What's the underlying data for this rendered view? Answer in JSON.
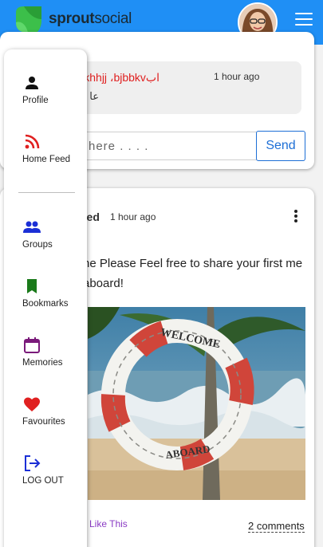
{
  "header": {
    "brand_bold": "sprout",
    "brand_rest": "social",
    "brand_color": "#1f8ff5"
  },
  "comment": {
    "author": "ابkhhjj ،bjbbkv",
    "time": "1 hour ago",
    "text": "عا"
  },
  "comment_input": {
    "placeholder": "here . . . .",
    "send_label": "Send"
  },
  "post": {
    "author": "hed",
    "time": "1 hour ago",
    "text": "he Please Feel free to share your first me aboard!",
    "image_text_top": "WELCOME",
    "image_text_bottom": "ABOARD",
    "like_label": "Like This",
    "comments_label": "2 comments"
  },
  "drawer": {
    "items": [
      {
        "label": "Profile",
        "icon": "person-icon",
        "color": "#111111"
      },
      {
        "label": "Home Feed",
        "icon": "rss-icon",
        "color": "#e02020"
      },
      {
        "label": "Groups",
        "icon": "groups-icon",
        "color": "#1b2fd6"
      },
      {
        "label": "Bookmarks",
        "icon": "bookmark-icon",
        "color": "#1a7a1a"
      },
      {
        "label": "Memories",
        "icon": "calendar-icon",
        "color": "#7a1a7a"
      },
      {
        "label": "Favourites",
        "icon": "heart-icon",
        "color": "#e02020"
      },
      {
        "label": "LOG OUT",
        "icon": "logout-icon",
        "color": "#1b2fd6"
      }
    ]
  }
}
